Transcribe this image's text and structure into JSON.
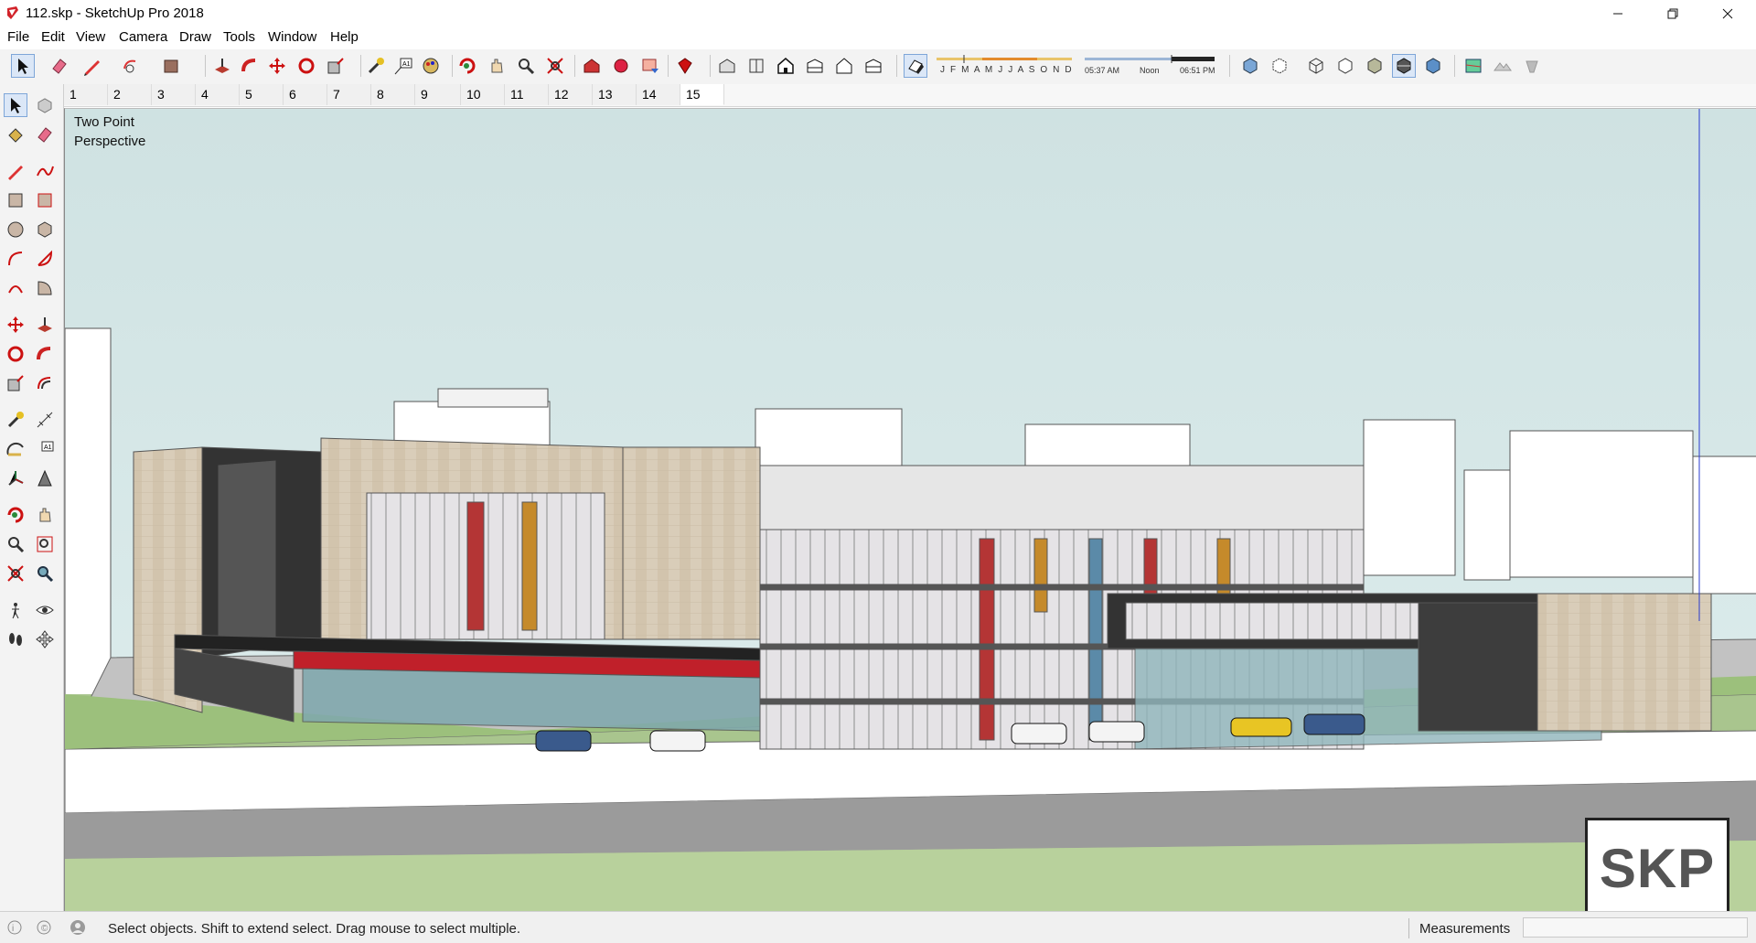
{
  "window": {
    "title": "112.skp - SketchUp Pro 2018",
    "controls": [
      "minimize",
      "restore",
      "close"
    ]
  },
  "menu": [
    "File",
    "Edit",
    "View",
    "Camera",
    "Draw",
    "Tools",
    "Window",
    "Help"
  ],
  "toolbar": {
    "shadow_months": "J F M A M J J A S O N D",
    "time_start": "05:37 AM",
    "time_noon": "Noon",
    "time_end": "06:51 PM"
  },
  "scenes": {
    "tabs": [
      "1",
      "2",
      "3",
      "4",
      "5",
      "6",
      "7",
      "8",
      "9",
      "10",
      "11",
      "12",
      "13",
      "14",
      "15"
    ],
    "active": "15"
  },
  "viewport": {
    "camera_label_line1": "Two Point",
    "camera_label_line2": "Perspective",
    "logo_text": "SKP"
  },
  "status": {
    "message": "Select objects. Shift to extend select. Drag mouse to select multiple.",
    "measurements_label": "Measurements",
    "measurements_value": ""
  },
  "colors": {
    "sky": "#d5e6e6",
    "grass": "#a9c58e",
    "stone": "#d9cdb9",
    "accent_red": "#c0202a"
  }
}
